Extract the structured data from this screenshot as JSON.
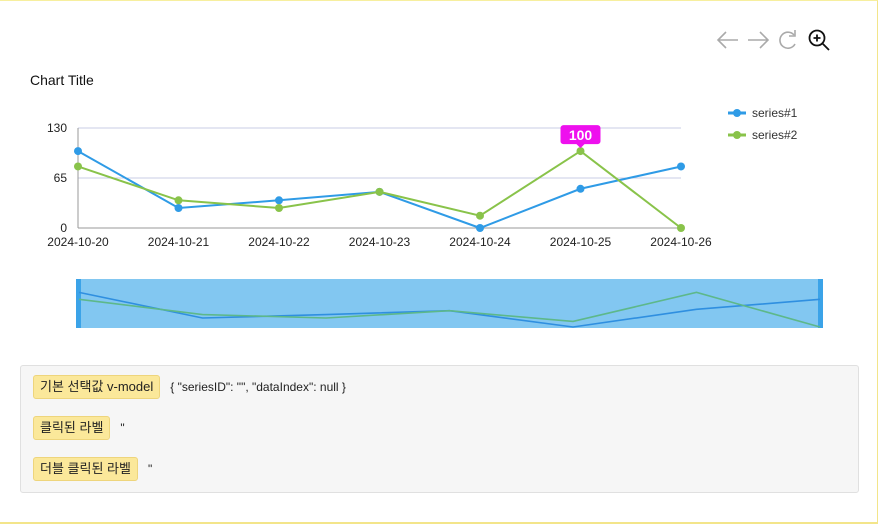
{
  "chart_data": {
    "type": "line",
    "title": "Chart Title",
    "categories": [
      "2024-10-20",
      "2024-10-21",
      "2024-10-22",
      "2024-10-23",
      "2024-10-24",
      "2024-10-25",
      "2024-10-26"
    ],
    "ylim": [
      0,
      130
    ],
    "yticks": [
      "0",
      "65",
      "130"
    ],
    "grid": true,
    "legend_position": "top-right",
    "series": [
      {
        "name": "series#1",
        "color": "#2f9be6",
        "values": [
          100,
          26,
          36,
          47,
          0,
          51,
          80
        ]
      },
      {
        "name": "series#2",
        "color": "#89c34a",
        "values": [
          80,
          36,
          26,
          47,
          16,
          100,
          0
        ]
      }
    ],
    "tooltip": {
      "series": 1,
      "index": 5,
      "text": "100",
      "color": "#ee10ee"
    }
  },
  "toolbar": {
    "back_icon": "arrow-left-icon",
    "forward_icon": "arrow-right-icon",
    "refresh_icon": "refresh-icon",
    "zoom_icon": "zoom-in-icon"
  },
  "info": {
    "selected_label": "기본 선택값 v-model",
    "selected_value": "{ \"seriesID\": \"\", \"dataIndex\": null }",
    "clicked_label": "클릭된 라벨",
    "clicked_value": "\"",
    "dblclicked_label": "더블 클릭된 라벨",
    "dblclicked_value": "\""
  }
}
